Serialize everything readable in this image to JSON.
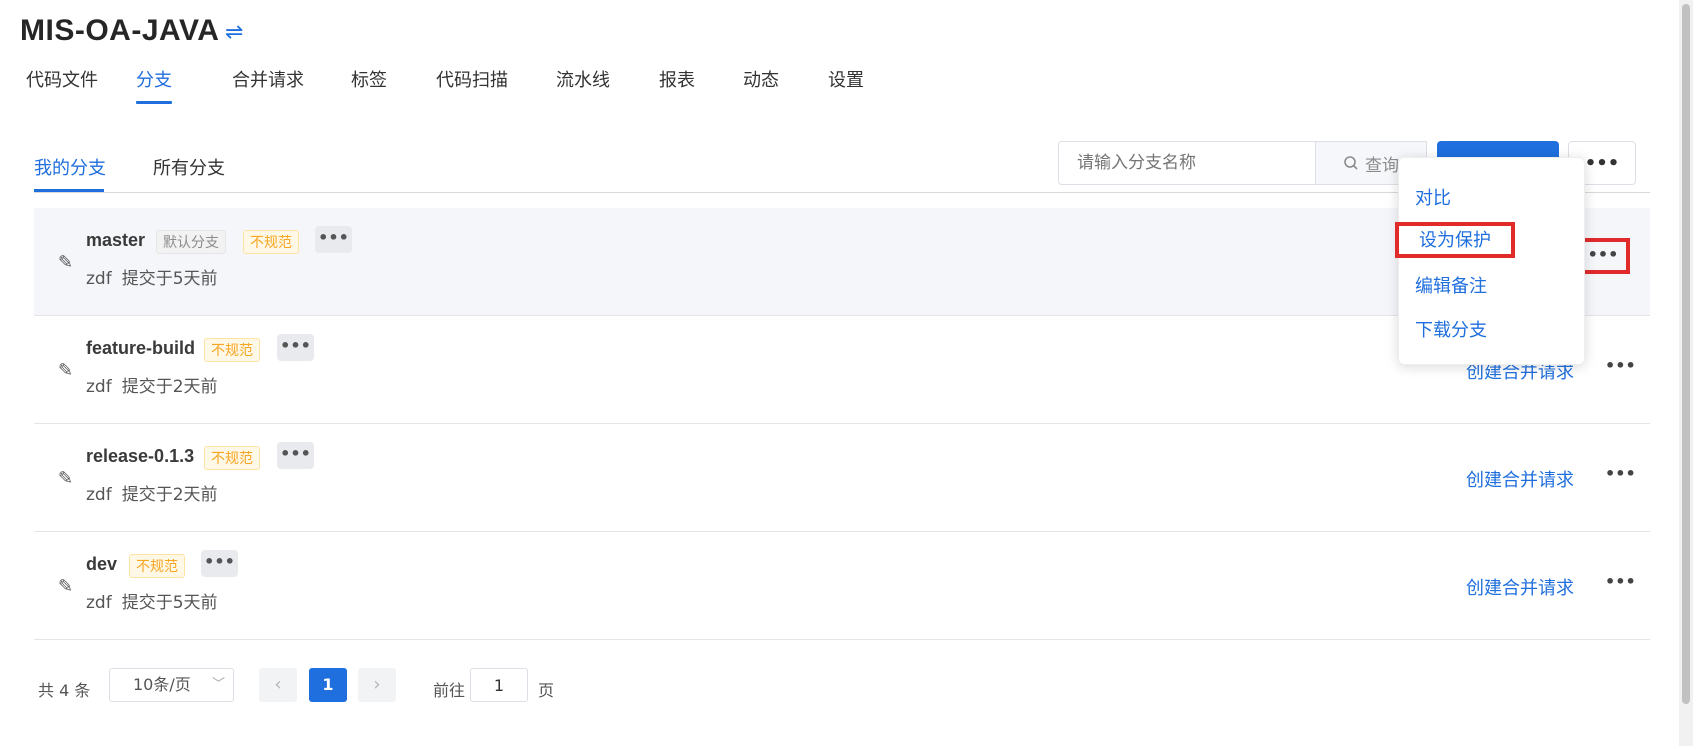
{
  "header": {
    "title": "MIS-OA-JAVA",
    "switch_icon": "swap-arrows-icon"
  },
  "nav": {
    "tabs": [
      "代码文件",
      "分支",
      "合并请求",
      "标签",
      "代码扫描",
      "流水线",
      "报表",
      "动态",
      "设置"
    ],
    "active_index": 1
  },
  "branch_tabs": {
    "mine": "我的分支",
    "all": "所有分支"
  },
  "toolbar": {
    "search_placeholder": "请输入分支名称",
    "search_button": "查询",
    "more_label": "•••"
  },
  "branches": [
    {
      "name": "master",
      "default_tag": "默认分支",
      "warn_tag": "不规范",
      "author": "zdf",
      "commit_time": "提交于5天前",
      "merge_link": ""
    },
    {
      "name": "feature-build",
      "warn_tag": "不规范",
      "author": "zdf",
      "commit_time": "提交于2天前",
      "merge_link": "创建合并请求"
    },
    {
      "name": "release-0.1.3",
      "warn_tag": "不规范",
      "author": "zdf",
      "commit_time": "提交于2天前",
      "merge_link": "创建合并请求"
    },
    {
      "name": "dev",
      "warn_tag": "不规范",
      "author": "zdf",
      "commit_time": "提交于5天前",
      "merge_link": "创建合并请求"
    }
  ],
  "dropdown": {
    "items": [
      "对比",
      "设为保护",
      "编辑备注",
      "下载分支"
    ]
  },
  "pagination": {
    "total": "共 4 条",
    "page_size": "10条/页",
    "current_page": "1",
    "goto_label": "前往",
    "goto_value": "1",
    "page_unit": "页"
  },
  "colors": {
    "accent": "#1f6fde",
    "warning": "#f5a623",
    "highlight": "#e12a2a"
  }
}
